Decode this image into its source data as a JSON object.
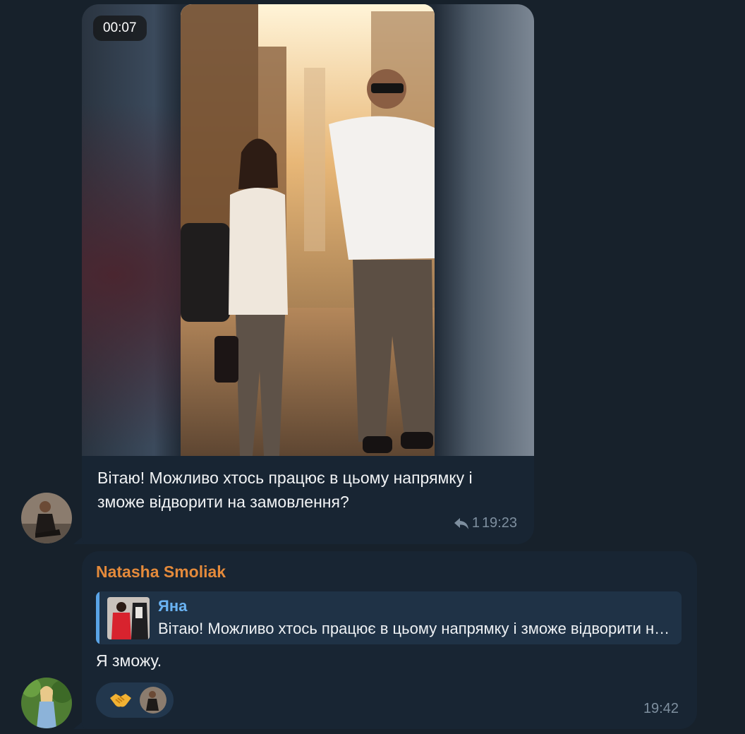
{
  "colors": {
    "background": "#17212b",
    "bubble": "#182533",
    "sender_name": "#e48a3b",
    "quote_accent": "#6ab3f3",
    "meta_text": "#7e8f9f"
  },
  "messages": [
    {
      "media": {
        "type": "video",
        "duration": "00:07",
        "thumbnail_icon": "video-thumbnail"
      },
      "text": "Вітаю! Можливо хтось працює в цьому напрямку і зможе відворити на замовлення?",
      "reply_count": "1",
      "reply_icon": "reply-arrow-icon",
      "time": "19:23",
      "avatar_icon": "user-avatar-icon"
    },
    {
      "sender": "Natasha Smoliak",
      "quote": {
        "author": "Яна",
        "text": "Вітаю! Можливо хтось працює в цьому напрямку і зможе відворити на замовлення?",
        "thumbnail_icon": "quote-thumbnail"
      },
      "text": "Я зможу.",
      "reaction": {
        "emoji_icon": "handshake-icon",
        "reactor_icon": "reactor-avatar-icon"
      },
      "time": "19:42",
      "avatar_icon": "user-avatar-icon"
    }
  ]
}
